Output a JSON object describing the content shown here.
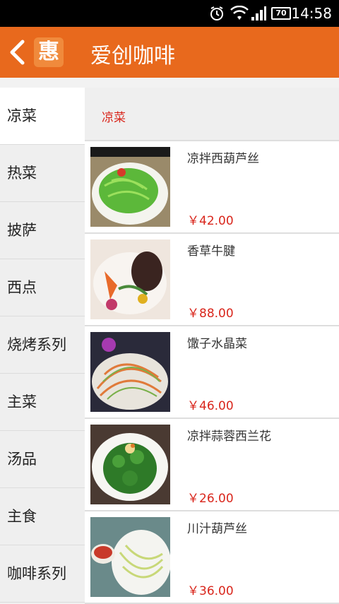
{
  "status": {
    "time": "14:58",
    "battery": "70"
  },
  "header": {
    "title": "爱创咖啡",
    "logo_char": "惠"
  },
  "sidebar": {
    "items": [
      {
        "label": "凉菜",
        "active": true
      },
      {
        "label": "热菜"
      },
      {
        "label": "披萨"
      },
      {
        "label": "西点"
      },
      {
        "label": "烧烤系列"
      },
      {
        "label": "主菜"
      },
      {
        "label": "汤品"
      },
      {
        "label": "主食"
      },
      {
        "label": "咖啡系列"
      }
    ]
  },
  "main": {
    "section_title": "凉菜",
    "items": [
      {
        "name": "凉拌西葫芦丝",
        "price": "￥42.00"
      },
      {
        "name": "香草牛腱",
        "price": "￥88.00"
      },
      {
        "name": "馓子水晶菜",
        "price": "￥46.00"
      },
      {
        "name": "凉拌蒜蓉西兰花",
        "price": "￥26.00"
      },
      {
        "name": "川汁葫芦丝",
        "price": "￥36.00"
      }
    ]
  },
  "colors": {
    "accent": "#e8691d",
    "price": "#d9261c"
  }
}
